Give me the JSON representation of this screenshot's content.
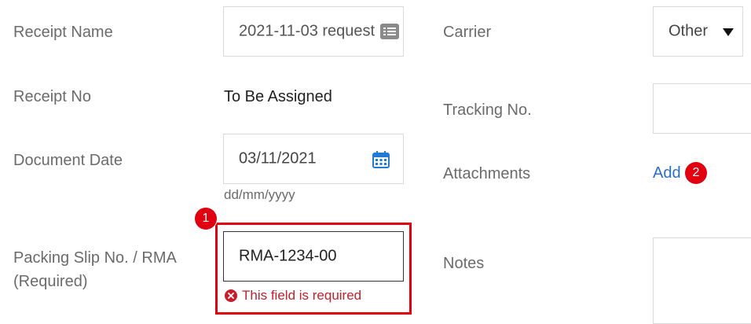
{
  "form": {
    "receipt_name": {
      "label": "Receipt Name",
      "value": "2021-11-03 request"
    },
    "receipt_no": {
      "label": "Receipt No",
      "value": "To Be Assigned"
    },
    "document_date": {
      "label": "Document Date",
      "value": "03/11/2021",
      "format_hint": "dd/mm/yyyy"
    },
    "packing_slip": {
      "label_line1": "Packing Slip No. / RMA",
      "label_line2": "(Required)",
      "value": "RMA-1234-00",
      "error": "This field is required"
    },
    "carrier": {
      "label": "Carrier",
      "selected": "Other"
    },
    "tracking_no": {
      "label": "Tracking No.",
      "value": ""
    },
    "attachments": {
      "label": "Attachments",
      "add_link": "Add"
    },
    "notes": {
      "label": "Notes",
      "value": ""
    }
  },
  "annotations": {
    "badge1": "1",
    "badge2": "2"
  },
  "colors": {
    "accent_red": "#e0000f",
    "link_blue": "#2a6fcd",
    "error_red": "#c4202b"
  },
  "icons": {
    "receipt_name_field": "text-list-icon",
    "document_date_field": "calendar-icon",
    "error": "error-x-circle-icon",
    "carrier_dropdown": "caret-down-icon"
  }
}
